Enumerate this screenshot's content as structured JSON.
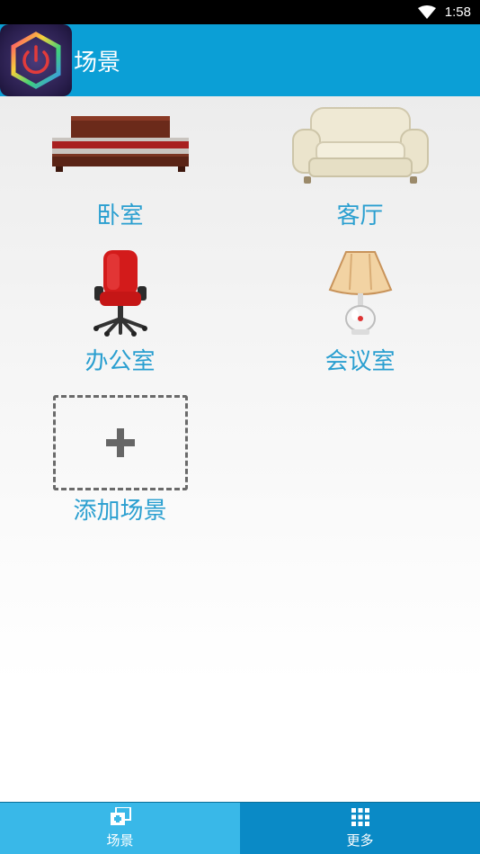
{
  "status_bar": {
    "time": "1:58"
  },
  "app_bar": {
    "title": "场景",
    "logo_icon": "power-hexagon-icon"
  },
  "scenes": [
    {
      "label": "卧室",
      "icon": "bed-icon"
    },
    {
      "label": "客厅",
      "icon": "sofa-icon"
    },
    {
      "label": "办公室",
      "icon": "office-chair-icon"
    },
    {
      "label": "会议室",
      "icon": "lamp-icon"
    }
  ],
  "add_scene": {
    "label": "添加场景",
    "icon": "plus-icon"
  },
  "bottom_nav": [
    {
      "label": "场景",
      "icon": "scene-add-icon",
      "active": true
    },
    {
      "label": "更多",
      "icon": "grid-dots-icon",
      "active": false
    }
  ],
  "colors": {
    "app_bar": "#0b9fd6",
    "label_blue": "#2a9fd0",
    "nav_active": "#39b8e8",
    "nav_inactive": "#0a8ac6"
  }
}
